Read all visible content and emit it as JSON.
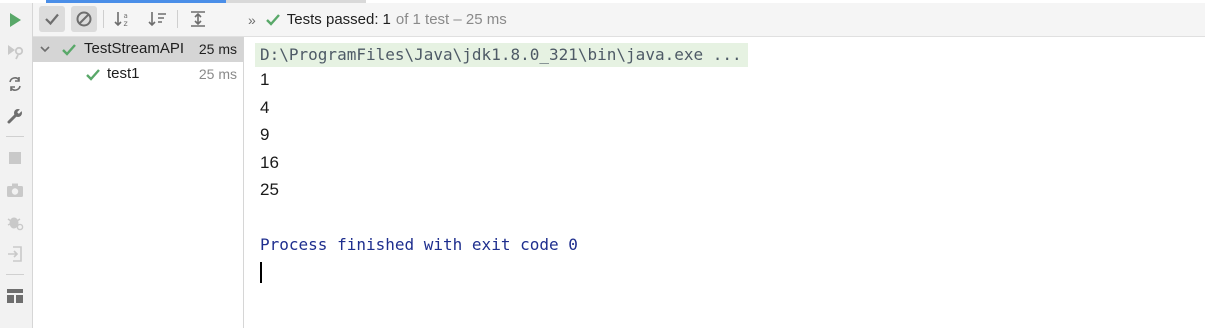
{
  "toolbar": {
    "buttons": [
      {
        "icon": "checkmark-icon",
        "toggled": true
      },
      {
        "icon": "cancel-icon",
        "toggled": true
      },
      {
        "icon": "sort-alphabetically-icon",
        "toggled": false
      },
      {
        "icon": "sort-by-duration-icon",
        "toggled": false
      },
      {
        "icon": "expand-all-icon",
        "toggled": false
      }
    ],
    "overflow_glyph": "»",
    "status": {
      "main": "Tests passed:",
      "count": "1",
      "rest": "of 1 test – 25 ms"
    }
  },
  "left_strip": {
    "icons": [
      "run-icon",
      "rerun-failed-icon",
      "toggle-auto-test-icon",
      "wrench-icon",
      "stop-icon",
      "camera-icon",
      "debug-settings-icon",
      "exit-icon",
      "layout-icon"
    ]
  },
  "tree": {
    "root": {
      "name": "TestStreamAPI",
      "duration": "25 ms"
    },
    "children": [
      {
        "name": "test1",
        "duration": "25 ms"
      }
    ]
  },
  "console": {
    "command": "D:\\ProgramFiles\\Java\\jdk1.8.0_321\\bin\\java.exe ...",
    "lines": [
      "1",
      "4",
      "9",
      "16",
      "25"
    ],
    "exit_message": "Process finished with exit code 0"
  },
  "colors": {
    "success_green": "#59a869",
    "exit_text": "#1e2e8e",
    "command_bg": "#e6f2e2",
    "accent": "#4a8ee8"
  }
}
